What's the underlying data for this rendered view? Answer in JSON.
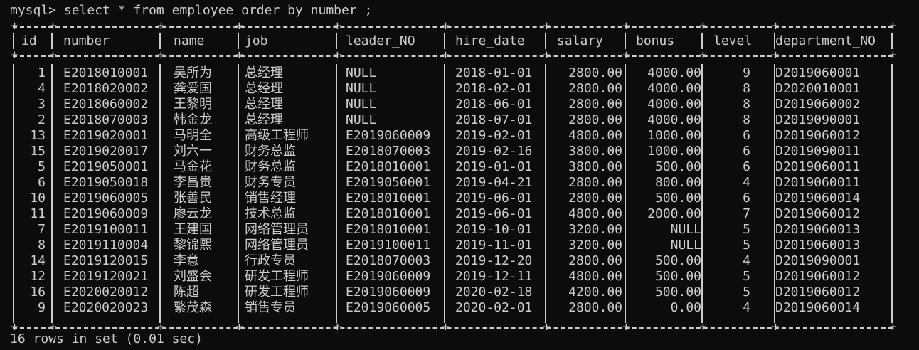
{
  "terminal": {
    "prompt": "mysql> select * from employee order by number ;",
    "footer": "16 rows in set (0.01 sec)"
  },
  "table": {
    "columns": [
      "id",
      "number",
      "name",
      "job",
      "leader_NO",
      "hire_date",
      "salary",
      "bonus",
      "level",
      "department_NO"
    ],
    "rows": [
      [
        "1",
        "E2018010001",
        "吴所为",
        "总经理",
        "NULL",
        "2018-01-01",
        "2800.00",
        "4000.00",
        "9",
        "D2019060001"
      ],
      [
        "4",
        "E2018020002",
        "龚爱国",
        "总经理",
        "NULL",
        "2018-02-01",
        "2800.00",
        "4000.00",
        "8",
        "D2020010001"
      ],
      [
        "3",
        "E2018060002",
        "王黎明",
        "总经理",
        "NULL",
        "2018-06-01",
        "2800.00",
        "4000.00",
        "8",
        "D2019060002"
      ],
      [
        "2",
        "E2018070003",
        "韩金龙",
        "总经理",
        "NULL",
        "2018-07-01",
        "2800.00",
        "4000.00",
        "8",
        "D2019090001"
      ],
      [
        "13",
        "E2019020001",
        "马明全",
        "高级工程师",
        "E2019060009",
        "2019-02-01",
        "4800.00",
        "1000.00",
        "6",
        "D2019060012"
      ],
      [
        "15",
        "E2019020017",
        "刘六一",
        "财务总监",
        "E2018070003",
        "2019-02-16",
        "3800.00",
        "1000.00",
        "6",
        "D2019090011"
      ],
      [
        "5",
        "E2019050001",
        "马金花",
        "财务总监",
        "E2018010001",
        "2019-01-01",
        "3800.00",
        "500.00",
        "6",
        "D2019060011"
      ],
      [
        "6",
        "E2019050018",
        "李昌贵",
        "财务专员",
        "E2019050001",
        "2019-04-21",
        "2800.00",
        "800.00",
        "4",
        "D2019060011"
      ],
      [
        "10",
        "E2019060005",
        "张善民",
        "销售经理",
        "E2018010001",
        "2019-06-01",
        "2800.00",
        "500.00",
        "6",
        "D2019060014"
      ],
      [
        "11",
        "E2019060009",
        "廖云龙",
        "技术总监",
        "E2018010001",
        "2019-06-01",
        "4800.00",
        "2000.00",
        "7",
        "D2019060012"
      ],
      [
        "7",
        "E2019100011",
        "王建国",
        "网络管理员",
        "E2018010001",
        "2019-10-01",
        "3200.00",
        "NULL",
        "5",
        "D2019060013"
      ],
      [
        "8",
        "E2019110004",
        "黎锦熙",
        "网络管理员",
        "E2019100011",
        "2019-11-01",
        "3200.00",
        "NULL",
        "5",
        "D2019060013"
      ],
      [
        "14",
        "E2019120015",
        "李意",
        "行政专员",
        "E2018070003",
        "2019-12-20",
        "2800.00",
        "500.00",
        "4",
        "D2019090001"
      ],
      [
        "12",
        "E2019120021",
        "刘盛会",
        "研发工程师",
        "E2019060009",
        "2019-12-11",
        "4800.00",
        "500.00",
        "5",
        "D2019060012"
      ],
      [
        "16",
        "E2020020012",
        "陈超",
        "研发工程师",
        "E2019060009",
        "2020-02-18",
        "4200.00",
        "500.00",
        "5",
        "D2019060012"
      ],
      [
        "9",
        "E2020020023",
        "繁茂森",
        "销售专员",
        "E2019060005",
        "2020-02-01",
        "2800.00",
        "0.00",
        "4",
        "D2019060014"
      ]
    ]
  }
}
